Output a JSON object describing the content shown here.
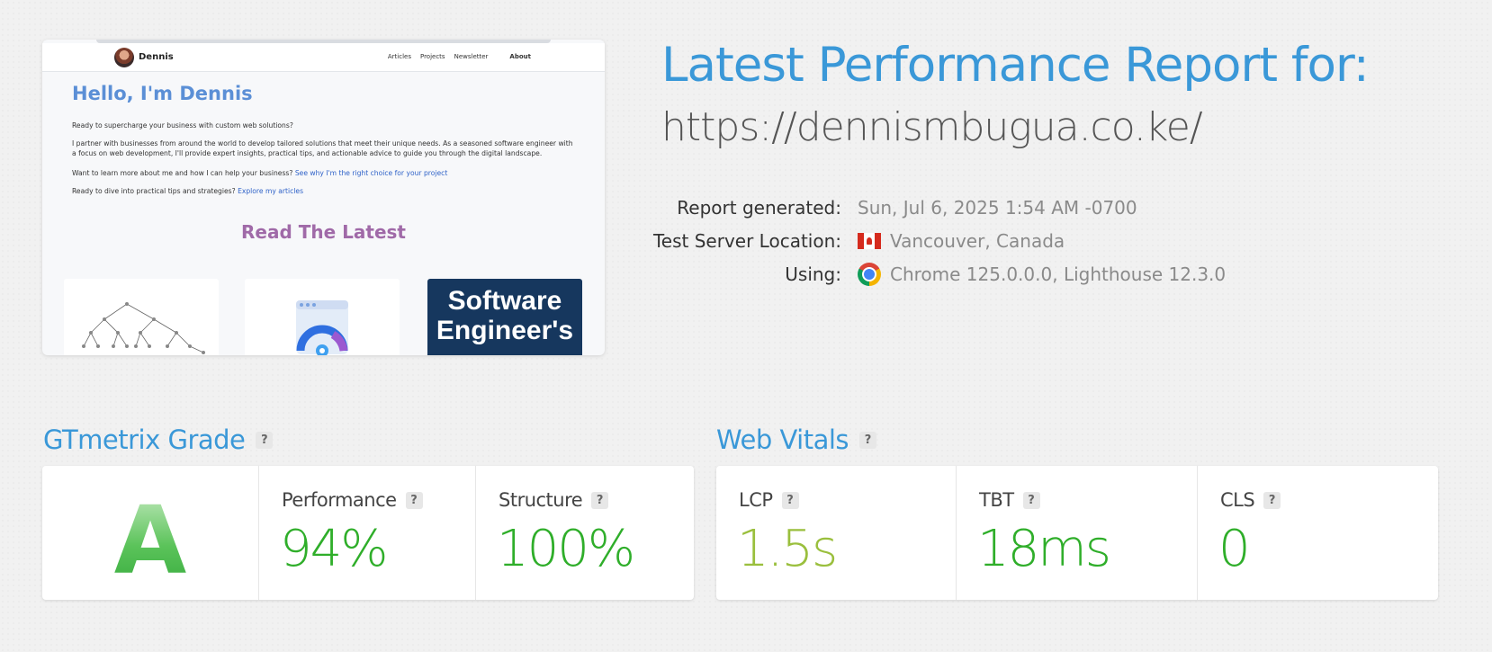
{
  "thumbnail": {
    "brand": "Dennis",
    "nav": [
      "Articles",
      "Projects",
      "Newsletter",
      "About"
    ],
    "hello": "Hello, I'm Dennis",
    "p1": "Ready to supercharge your business with custom web solutions?",
    "p2": "I partner with businesses from around the world to develop tailored solutions that meet their unique needs. As a seasoned software engineer with a focus on web development, I'll provide expert insights, practical tips, and actionable advice to guide you through the digital landscape.",
    "p3_text": "Want to learn more about me and how I can help your business?",
    "p3_link": "See why I'm the right choice for your project",
    "p4_text": "Ready to dive into practical tips and strategies?",
    "p4_link": "Explore my articles",
    "read_latest": "Read The Latest",
    "card3_text": "Software Engineer's"
  },
  "report": {
    "title": "Latest Performance Report for:",
    "url": "https://dennismbugua.co.ke/",
    "generated_label": "Report generated:",
    "generated_value": "Sun, Jul 6, 2025 1:54 AM -0700",
    "location_label": "Test Server Location:",
    "location_value": "Vancouver, Canada",
    "using_label": "Using:",
    "using_value": "Chrome 125.0.0.0, Lighthouse 12.3.0",
    "icons": {
      "flag": "canada-flag-icon",
      "browser": "chrome-icon"
    }
  },
  "grade": {
    "heading": "GTmetrix Grade",
    "help": "?",
    "letter": "A",
    "performance_label": "Performance",
    "performance_value": "94%",
    "structure_label": "Structure",
    "structure_value": "100%"
  },
  "vitals": {
    "heading": "Web Vitals",
    "help": "?",
    "lcp_label": "LCP",
    "lcp_value": "1.5s",
    "tbt_label": "TBT",
    "tbt_value": "18ms",
    "cls_label": "CLS",
    "cls_value": "0"
  },
  "colors": {
    "accent": "#3a98d8",
    "good": "#2fae2a",
    "ok": "#9abf3d"
  }
}
